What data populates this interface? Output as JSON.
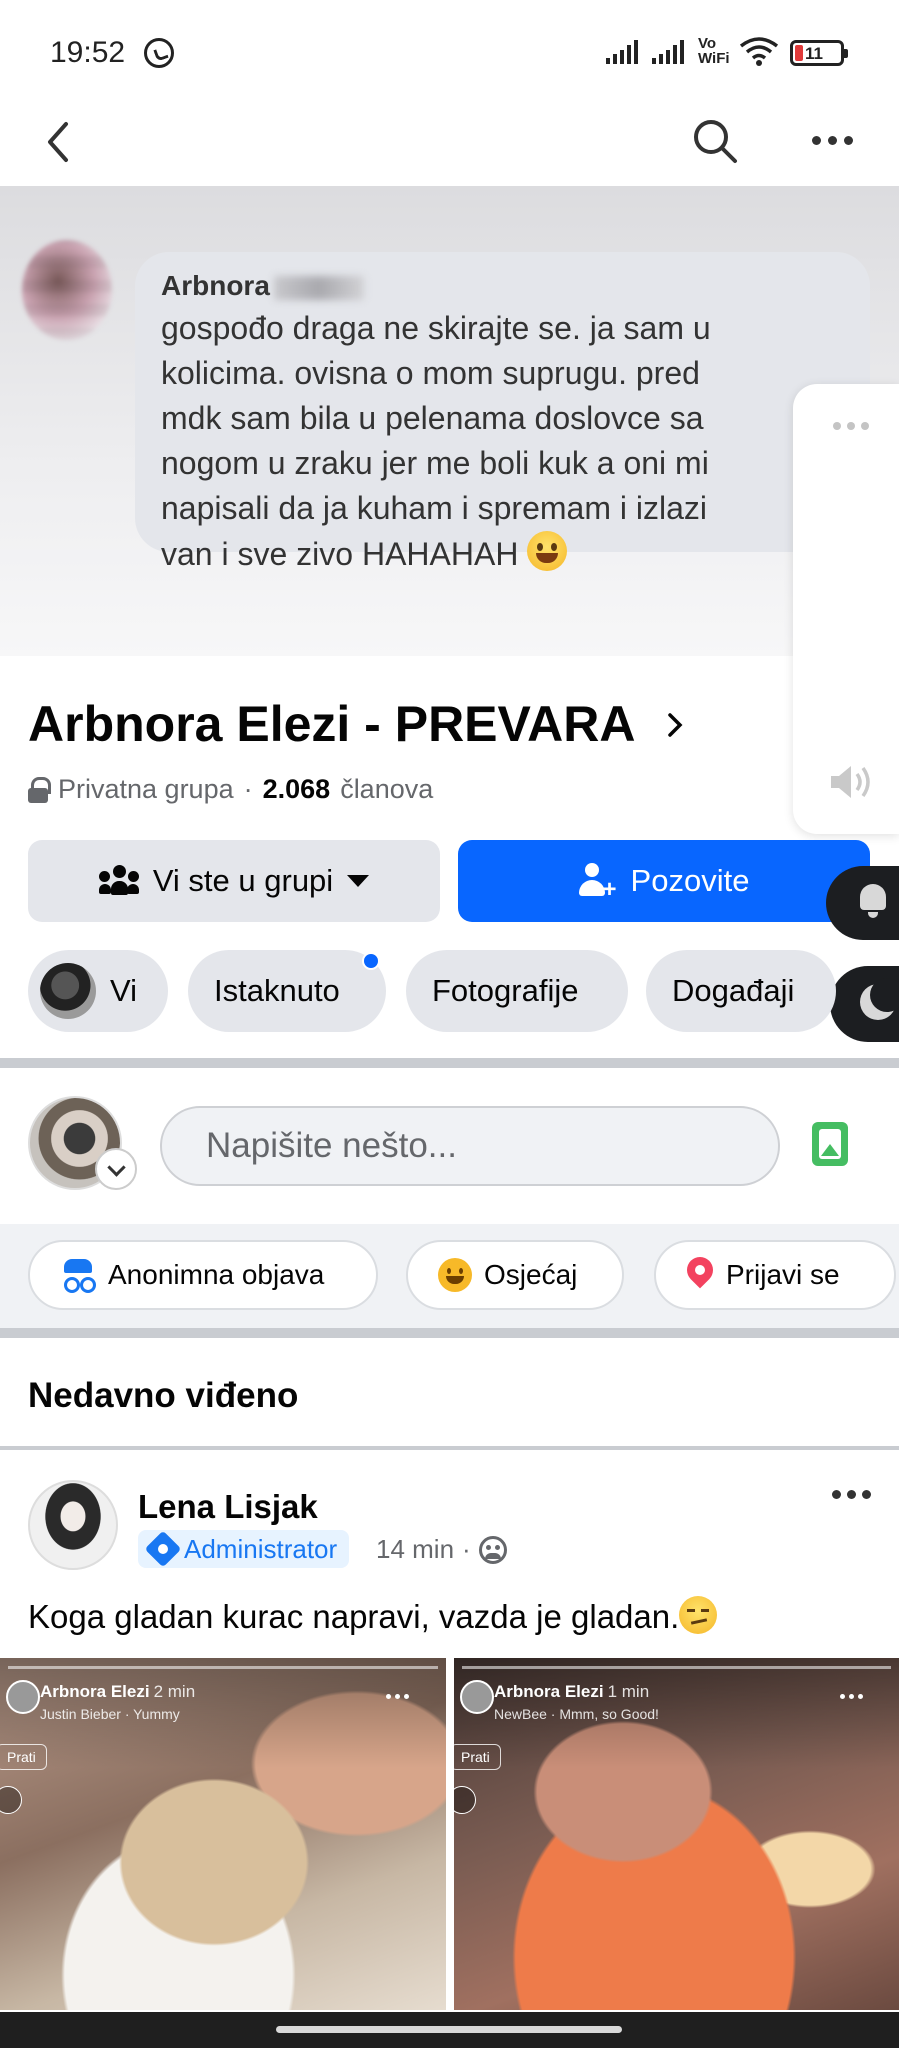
{
  "status_bar": {
    "time": "19:52",
    "vowifi_line1": "Vo",
    "vowifi_line2": "WiFi",
    "battery_level": "11",
    "icons": [
      "whatsapp-icon",
      "signal-icon",
      "signal-icon",
      "wifi-icon",
      "battery-icon"
    ]
  },
  "topnav": {
    "icons": [
      "back-icon",
      "search-icon",
      "more-icon"
    ]
  },
  "cover": {
    "author_visible": "Arbnora",
    "message": "gospođo draga ne skirajte se. ja sam u\nkolicima. ovisna o mom suprugu. pred\nmdk sam bila u pelenama doslovce sa\nnogom u zraku jer me boli kuk a oni mi\nnapisali da ja kuham i spremam i izlazi\nvan i sve zivo HAHAHAH"
  },
  "group": {
    "title": "Arbnora Elezi - PREVARA",
    "privacy": "Privatna grupa",
    "separator": "·",
    "member_count": "2.068",
    "member_word": "članova"
  },
  "buttons": {
    "joined_label": "Vi ste u grupi",
    "invite_label": "Pozovite",
    "add_plus": "+"
  },
  "tabs": [
    {
      "label": "Vi"
    },
    {
      "label": "Istaknuto",
      "has_dot": true
    },
    {
      "label": "Fotografije"
    },
    {
      "label": "Događaji"
    }
  ],
  "composer": {
    "placeholder": "Napišite nešto..."
  },
  "action_chips": [
    {
      "label": "Anonimna objava",
      "icon": "anonymous-icon"
    },
    {
      "label": "Osjećaj",
      "icon": "feeling-icon"
    },
    {
      "label": "Prijavi se",
      "icon": "location-pin-icon"
    }
  ],
  "section": {
    "title": "Nedavno viđeno"
  },
  "post": {
    "author": "Lena Lisjak",
    "badge": "Administrator",
    "time": "14 min",
    "time_separator": "·",
    "text": "Koga gladan kurac napravi, vazda je gladan.",
    "media": [
      {
        "user": "Arbnora Elezi",
        "ago": "2 min",
        "song": "Justin Bieber · Yummy",
        "follow": "Prati"
      },
      {
        "user": "Arbnora Elezi",
        "ago": "1 min",
        "song": "NewBee · Mmm, so Good!",
        "follow": "Prati"
      }
    ]
  },
  "colors": {
    "accent": "#0866ff",
    "chip_bg": "#e4e6eb",
    "secondary_text": "#65676b"
  }
}
